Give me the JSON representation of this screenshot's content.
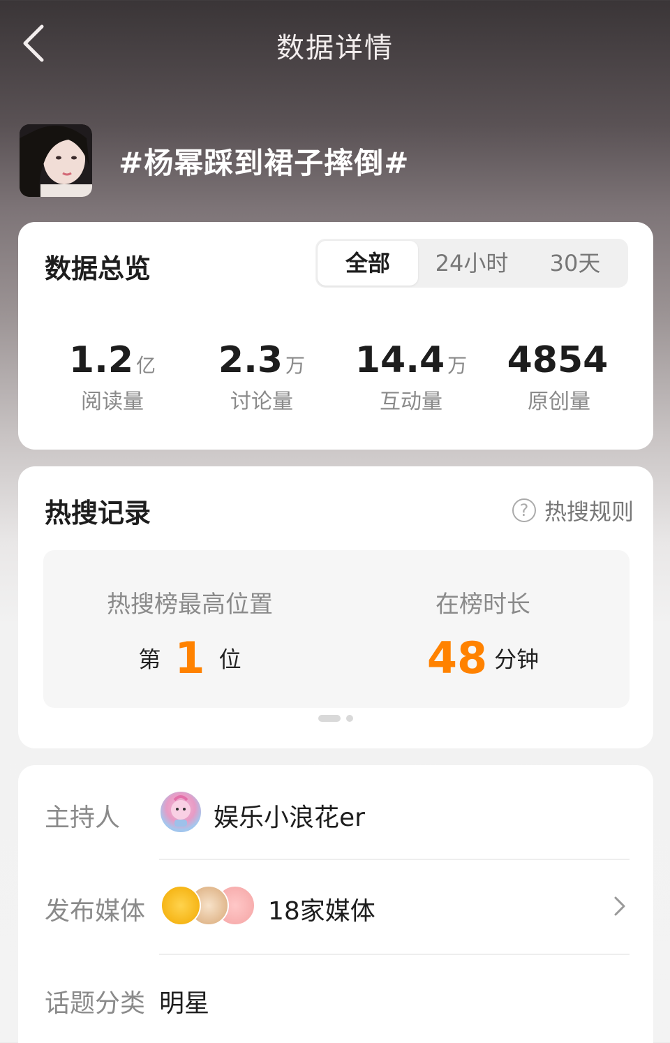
{
  "header": {
    "title": "数据详情",
    "back_icon": "chevron-left-icon"
  },
  "topic": {
    "title": "#杨幂踩到裙子摔倒#"
  },
  "overview": {
    "heading": "数据总览",
    "tabs": [
      {
        "label": "全部",
        "active": true
      },
      {
        "label": "24小时",
        "active": false
      },
      {
        "label": "30天",
        "active": false
      }
    ],
    "stats": [
      {
        "value": "1.2",
        "unit": "亿",
        "label": "阅读量"
      },
      {
        "value": "2.3",
        "unit": "万",
        "label": "讨论量"
      },
      {
        "value": "14.4",
        "unit": "万",
        "label": "互动量"
      },
      {
        "value": "4854",
        "unit": "",
        "label": "原创量"
      }
    ]
  },
  "hot_search": {
    "heading": "热搜记录",
    "rules_label": "热搜规则",
    "best_rank": {
      "label": "热搜榜最高位置",
      "prefix": "第",
      "value": "1",
      "suffix": "位"
    },
    "duration": {
      "label": "在榜时长",
      "value": "48",
      "unit": "分钟"
    },
    "accent_color": "#ff8200",
    "page_indicator": {
      "count": 2,
      "active": 1
    }
  },
  "info": {
    "host": {
      "label": "主持人",
      "name": "娱乐小浪花er"
    },
    "media": {
      "label": "发布媒体",
      "value": "18家媒体"
    },
    "category": {
      "label": "话题分类",
      "value": "明星"
    }
  }
}
